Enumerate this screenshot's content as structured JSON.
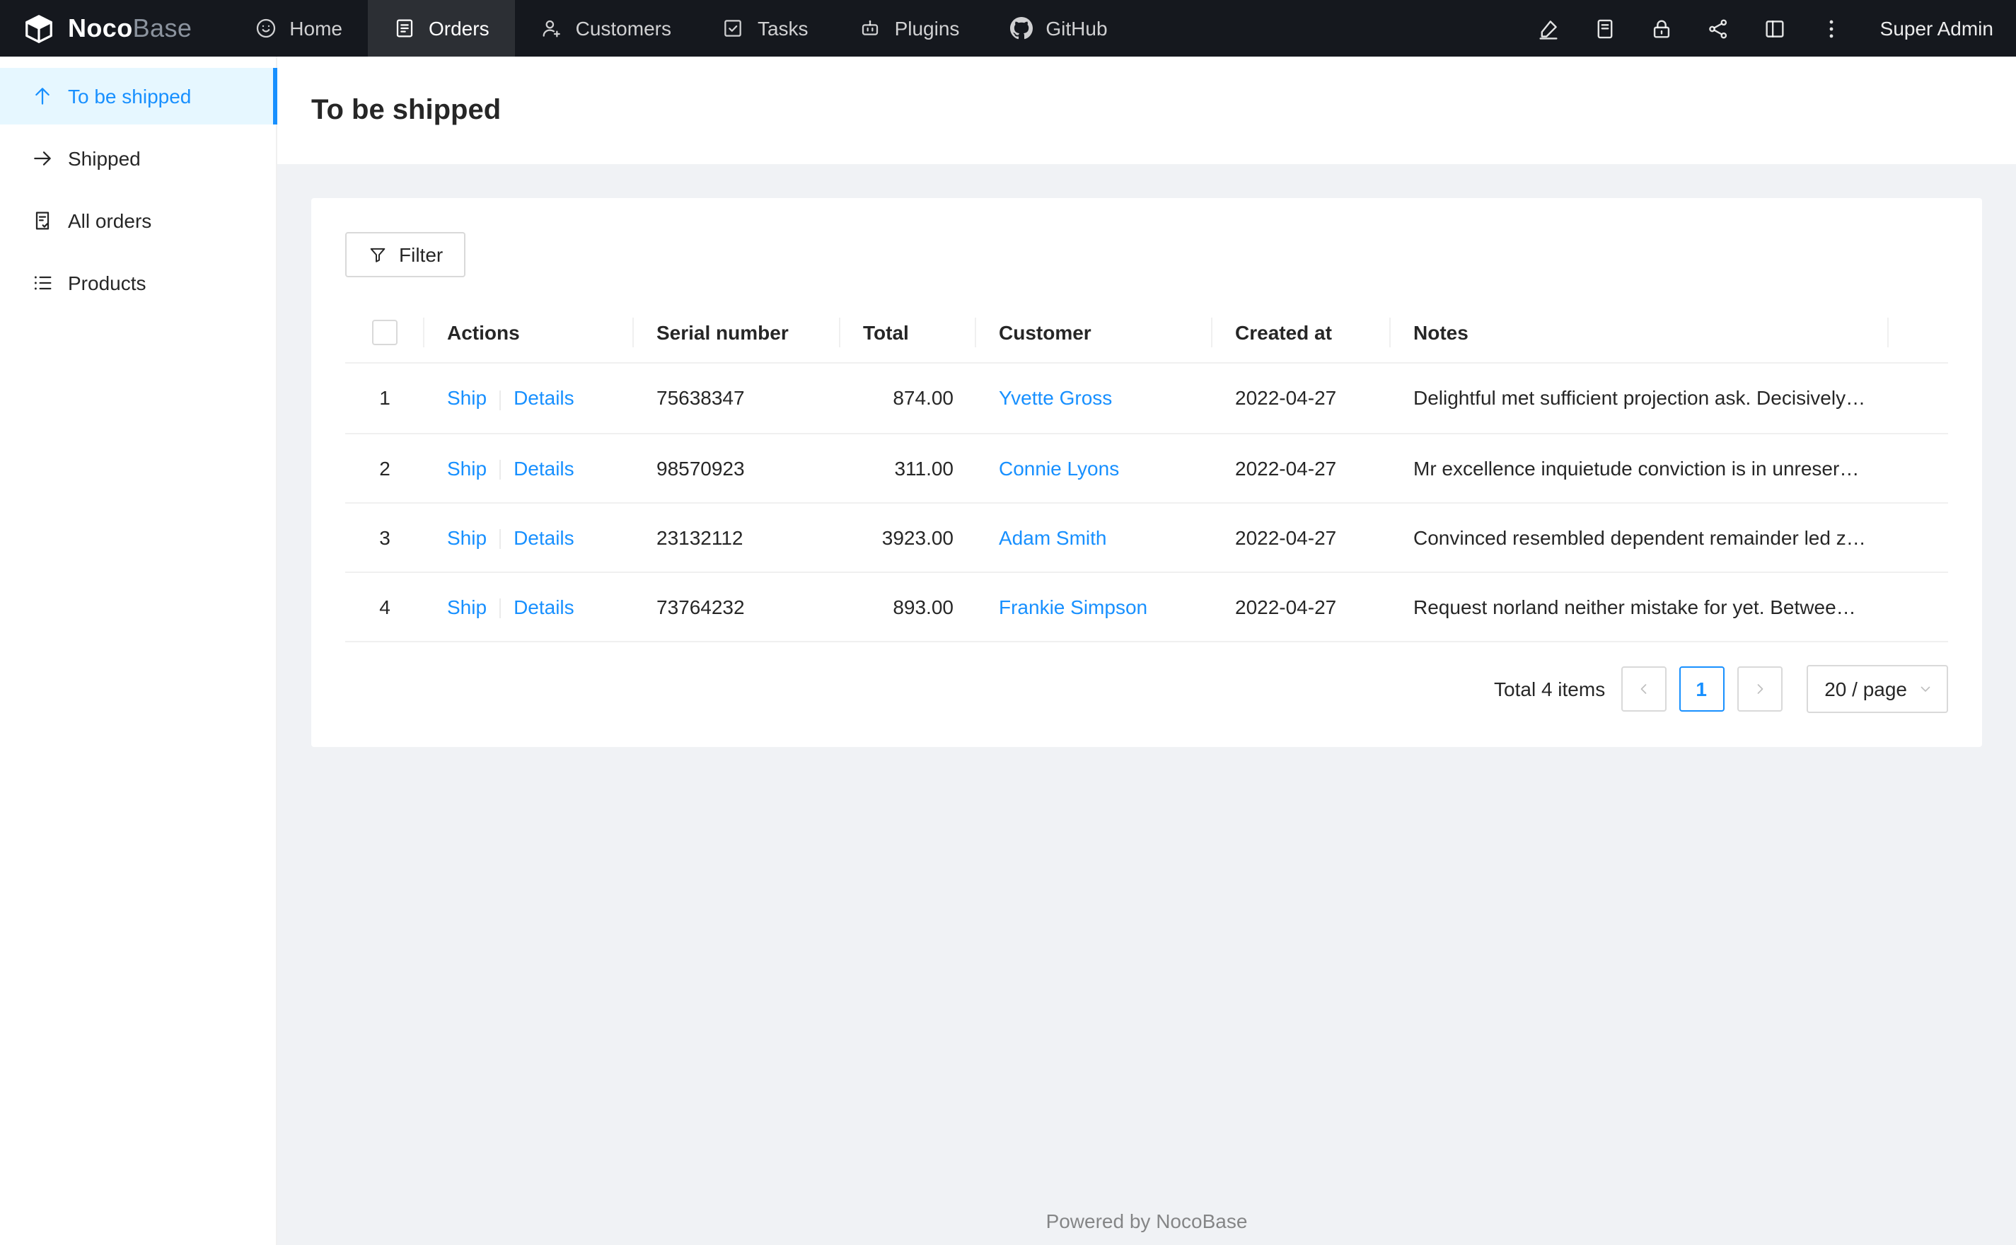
{
  "brand": {
    "name_primary": "Noco",
    "name_secondary": "Base"
  },
  "topnav": {
    "items": [
      {
        "label": "Home",
        "icon": "smile-icon"
      },
      {
        "label": "Orders",
        "icon": "orders-icon"
      },
      {
        "label": "Customers",
        "icon": "user-add-icon"
      },
      {
        "label": "Tasks",
        "icon": "check-square-icon"
      },
      {
        "label": "Plugins",
        "icon": "robot-icon"
      },
      {
        "label": "GitHub",
        "icon": "github-icon"
      }
    ],
    "active_item": "Orders",
    "action_icons": [
      "highlighter-icon",
      "book-icon",
      "lock-icon",
      "share-icon",
      "layout-icon",
      "more-icon"
    ],
    "user": "Super Admin"
  },
  "sidebar": {
    "items": [
      {
        "label": "To be shipped",
        "icon": "arrow-up-icon"
      },
      {
        "label": "Shipped",
        "icon": "arrow-right-icon"
      },
      {
        "label": "All orders",
        "icon": "audit-icon"
      },
      {
        "label": "Products",
        "icon": "list-icon"
      }
    ],
    "active_item": "To be shipped"
  },
  "page": {
    "title": "To be shipped"
  },
  "toolbar": {
    "filter_label": "Filter"
  },
  "table": {
    "columns": [
      "Actions",
      "Serial number",
      "Total",
      "Customer",
      "Created at",
      "Notes"
    ],
    "action_labels": {
      "ship": "Ship",
      "details": "Details"
    },
    "rows": [
      {
        "index": "1",
        "serial": "75638347",
        "total": "874.00",
        "customer": "Yvette Gross",
        "created_at": "2022-04-27",
        "notes": "Delightful met sufficient projection ask. Decisively ev..."
      },
      {
        "index": "2",
        "serial": "98570923",
        "total": "311.00",
        "customer": "Connie Lyons",
        "created_at": "2022-04-27",
        "notes": "Mr excellence inquietude conviction is in unreserved..."
      },
      {
        "index": "3",
        "serial": "23132112",
        "total": "3923.00",
        "customer": "Adam Smith",
        "created_at": "2022-04-27",
        "notes": "Convinced resembled dependent remainder led zeal..."
      },
      {
        "index": "4",
        "serial": "73764232",
        "total": "893.00",
        "customer": "Frankie Simpson",
        "created_at": "2022-04-27",
        "notes": "Request norland neither mistake for yet. Between th..."
      }
    ]
  },
  "pagination": {
    "total_text": "Total 4 items",
    "current_page": "1",
    "page_size": "20 / page"
  },
  "footer": {
    "text": "Powered by NocoBase"
  },
  "colors": {
    "accent": "#1890ff",
    "header_bg": "#15181e",
    "sidebar_active_bg": "#e6f7ff",
    "page_bg": "#f0f2f5",
    "border": "#f0f0f0",
    "control_border": "#d9d9d9"
  }
}
